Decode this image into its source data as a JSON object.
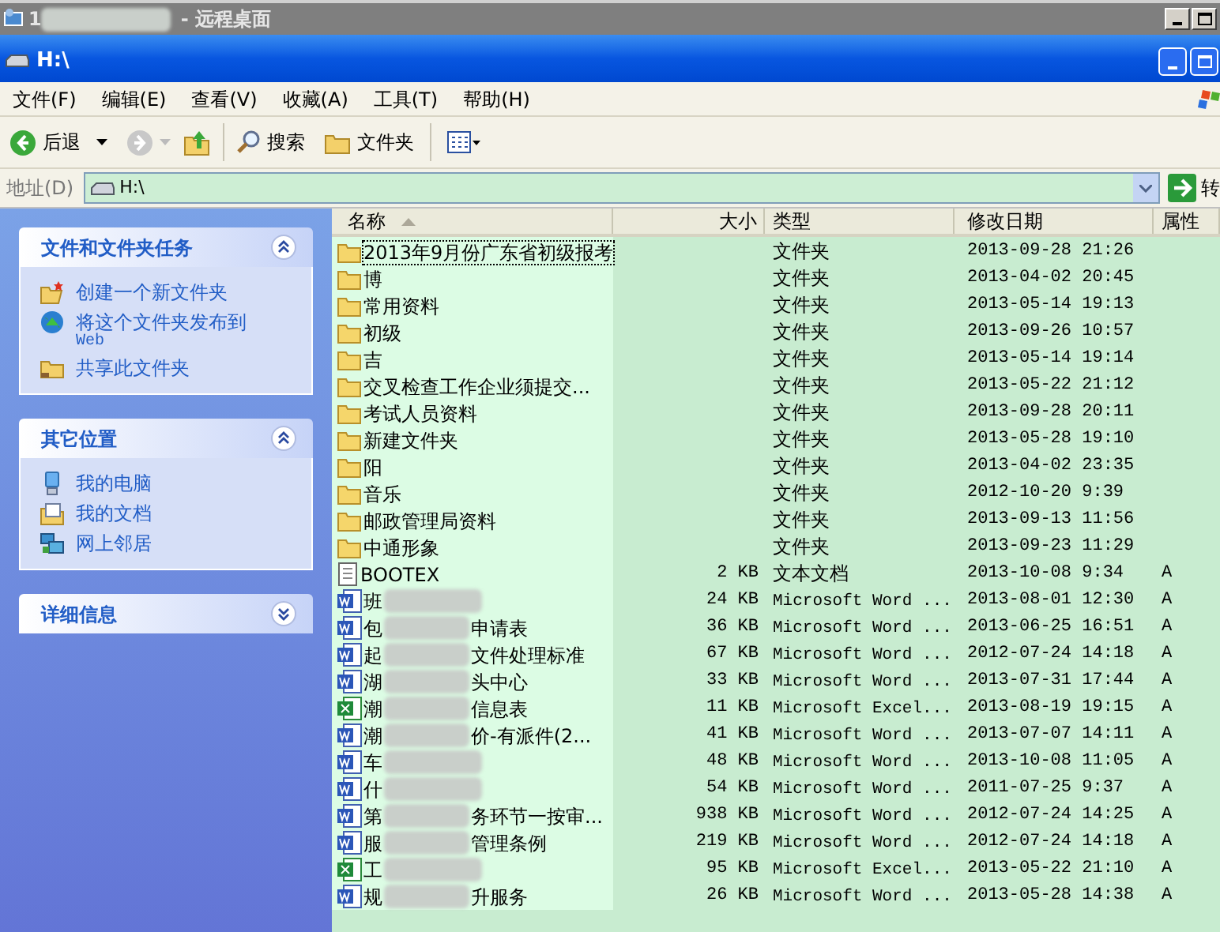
{
  "remote_title": {
    "start": "1",
    "end": "- 远程桌面"
  },
  "window": {
    "title": "H:\\"
  },
  "menu": [
    "文件(F)",
    "编辑(E)",
    "查看(V)",
    "收藏(A)",
    "工具(T)",
    "帮助(H)"
  ],
  "toolbar": {
    "back": "后退",
    "search": "搜索",
    "folders": "文件夹"
  },
  "address": {
    "label": "地址(D)",
    "value": "H:\\",
    "go": "转"
  },
  "panels": [
    {
      "title": "文件和文件夹任务",
      "expanded": true,
      "items": [
        {
          "label": "创建一个新文件夹"
        },
        {
          "label": "将这个文件夹发布到",
          "label2": "Web"
        },
        {
          "label": "共享此文件夹"
        }
      ]
    },
    {
      "title": "其它位置",
      "expanded": true,
      "items": [
        {
          "label": "我的电脑"
        },
        {
          "label": "我的文档"
        },
        {
          "label": "网上邻居"
        }
      ]
    },
    {
      "title": "详细信息",
      "expanded": false
    }
  ],
  "table": {
    "columns": [
      {
        "label": "名称",
        "sorted": true
      },
      {
        "label": "大小",
        "sorted": false
      },
      {
        "label": "类型",
        "sorted": false
      },
      {
        "label": "修改日期",
        "sorted": false
      },
      {
        "label": "属性",
        "sorted": false
      }
    ],
    "rows": [
      {
        "kind": "folder",
        "name": "2013年9月份广东省初级报考",
        "type": "文件夹",
        "date": "2013-09-28 21:26",
        "focused": true
      },
      {
        "kind": "folder",
        "name": "博",
        "type": "文件夹",
        "date": "2013-04-02 20:45",
        "focused": false
      },
      {
        "kind": "folder",
        "name": "常用资料",
        "type": "文件夹",
        "date": "2013-05-14 19:13",
        "focused": false
      },
      {
        "kind": "folder",
        "name": "初级",
        "type": "文件夹",
        "date": "2013-09-26 10:57",
        "focused": false
      },
      {
        "kind": "folder",
        "name": "吉",
        "type": "文件夹",
        "date": "2013-05-14 19:14",
        "focused": false
      },
      {
        "kind": "folder",
        "name": "交叉检查工作企业须提交...",
        "type": "文件夹",
        "date": "2013-05-22 21:12",
        "focused": false
      },
      {
        "kind": "folder",
        "name": "考试人员资料",
        "type": "文件夹",
        "date": "2013-09-28 20:11",
        "focused": false
      },
      {
        "kind": "folder",
        "name": "新建文件夹",
        "type": "文件夹",
        "date": "2013-05-28 19:10",
        "focused": false
      },
      {
        "kind": "folder",
        "name": "阳",
        "type": "文件夹",
        "date": "2013-04-02 23:35",
        "focused": false
      },
      {
        "kind": "folder",
        "name": "音乐",
        "type": "文件夹",
        "date": "2012-10-20 9:39",
        "focused": false
      },
      {
        "kind": "folder",
        "name": "邮政管理局资料",
        "type": "文件夹",
        "date": "2013-09-13 11:56",
        "focused": false
      },
      {
        "kind": "folder",
        "name": "中通形象",
        "type": "文件夹",
        "date": "2013-09-23 11:29",
        "focused": false
      },
      {
        "kind": "text",
        "name": "BOOTEX",
        "size": "2 KB",
        "type": "文本文档",
        "date": "2013-10-08 9:34",
        "attr": "A",
        "focused": false
      },
      {
        "kind": "word",
        "name": "班",
        "blurred": true,
        "size": "24 KB",
        "type": "Microsoft Word ...",
        "date": "2013-08-01 12:30",
        "attr": "A",
        "focused": false
      },
      {
        "kind": "word",
        "name": "包",
        "blurred": true,
        "name_end": "申请表",
        "size": "36 KB",
        "type": "Microsoft Word ...",
        "date": "2013-06-25 16:51",
        "attr": "A",
        "focused": false
      },
      {
        "kind": "word",
        "name": "起",
        "blurred": true,
        "name_end": "文件处理标准",
        "size": "67 KB",
        "type": "Microsoft Word ...",
        "date": "2012-07-24 14:18",
        "attr": "A",
        "focused": false
      },
      {
        "kind": "word",
        "name": "湖",
        "blurred": true,
        "name_end": "头中心",
        "size": "33 KB",
        "type": "Microsoft Word ...",
        "date": "2013-07-31 17:44",
        "attr": "A",
        "focused": false
      },
      {
        "kind": "excel",
        "name": "潮",
        "blurred": true,
        "name_end": "信息表",
        "size": "11 KB",
        "type": "Microsoft Excel...",
        "date": "2013-08-19 19:15",
        "attr": "A",
        "focused": false
      },
      {
        "kind": "word",
        "name": "潮",
        "blurred": true,
        "name_end": "价-有派件(2...",
        "size": "41 KB",
        "type": "Microsoft Word ...",
        "date": "2013-07-07 14:11",
        "attr": "A",
        "focused": false
      },
      {
        "kind": "word",
        "name": "车",
        "blurred": true,
        "size": "48 KB",
        "type": "Microsoft Word ...",
        "date": "2013-10-08 11:05",
        "attr": "A",
        "focused": false
      },
      {
        "kind": "word",
        "name": "什",
        "blurred": true,
        "size": "54 KB",
        "type": "Microsoft Word ...",
        "date": "2011-07-25 9:37",
        "attr": "A",
        "focused": false
      },
      {
        "kind": "word",
        "name": "第",
        "blurred": true,
        "name_end": "务环节一按审...",
        "size": "938 KB",
        "type": "Microsoft Word ...",
        "date": "2012-07-24 14:25",
        "attr": "A",
        "focused": false
      },
      {
        "kind": "word",
        "name": "服",
        "blurred": true,
        "name_end": "管理条例",
        "size": "219 KB",
        "type": "Microsoft Word ...",
        "date": "2012-07-24 14:18",
        "attr": "A",
        "focused": false
      },
      {
        "kind": "excel",
        "name": "工",
        "blurred": true,
        "size": "95 KB",
        "type": "Microsoft Excel...",
        "date": "2013-05-22 21:10",
        "attr": "A",
        "focused": false
      },
      {
        "kind": "word",
        "name": "规",
        "blurred": true,
        "name_end": "升服务",
        "size": "26 KB",
        "type": "Microsoft Word ...",
        "date": "2013-05-28 14:38",
        "attr": "A",
        "focused": false
      }
    ]
  }
}
